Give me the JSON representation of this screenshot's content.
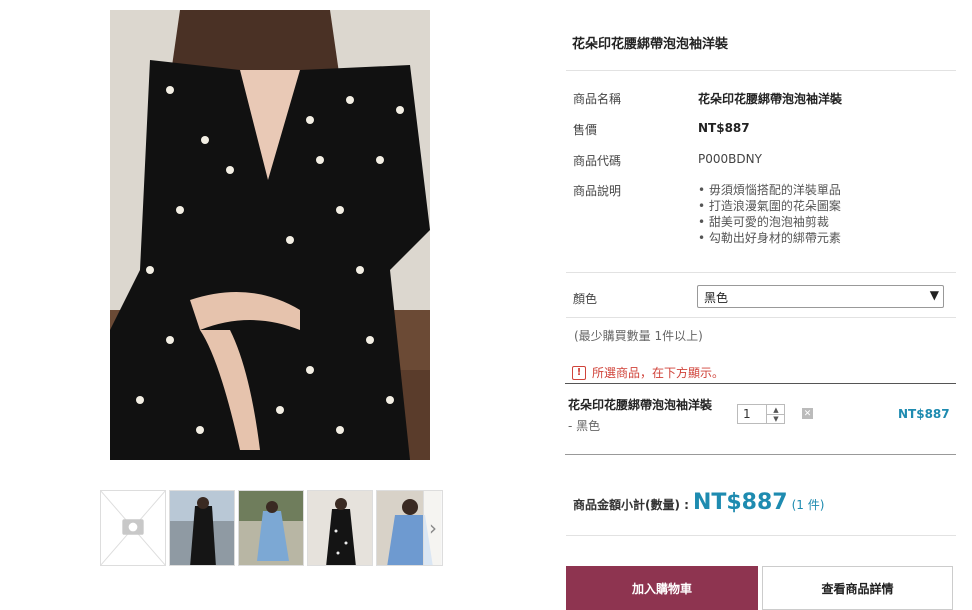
{
  "product": {
    "title": "花朵印花腰綁帶泡泡袖洋裝",
    "name_label": "商品名稱",
    "name_value": "花朵印花腰綁帶泡泡袖洋裝",
    "price_label": "售價",
    "price_value": "NT$887",
    "code_label": "商品代碼",
    "code_value": "P000BDNY",
    "desc_label": "商品說明",
    "desc_items": [
      "毋須煩惱搭配的洋裝單品",
      "打造浪漫氣圍的花朵圖案",
      "甜美可愛的泡泡袖剪裁",
      "勾勒出好身材的綁帶元素"
    ]
  },
  "options": {
    "color_label": "顏色",
    "color_value": "黑色",
    "min_note": "(最少購買數量 1件以上)",
    "warning": "所選商品，在下方顯示。"
  },
  "selected": {
    "name": "花朵印花腰綁帶泡泡袖洋裝",
    "option": "- 黑色",
    "qty": "1",
    "price": "NT$887"
  },
  "total": {
    "label": "商品金額小計(數量) :",
    "price": "NT$887",
    "count": "(1 件)"
  },
  "buttons": {
    "add_cart": "加入購物車",
    "details": "查看商品詳情"
  },
  "colors": {
    "accent": "#8e3450",
    "price": "#1e8bb0",
    "warning": "#d0433a"
  }
}
